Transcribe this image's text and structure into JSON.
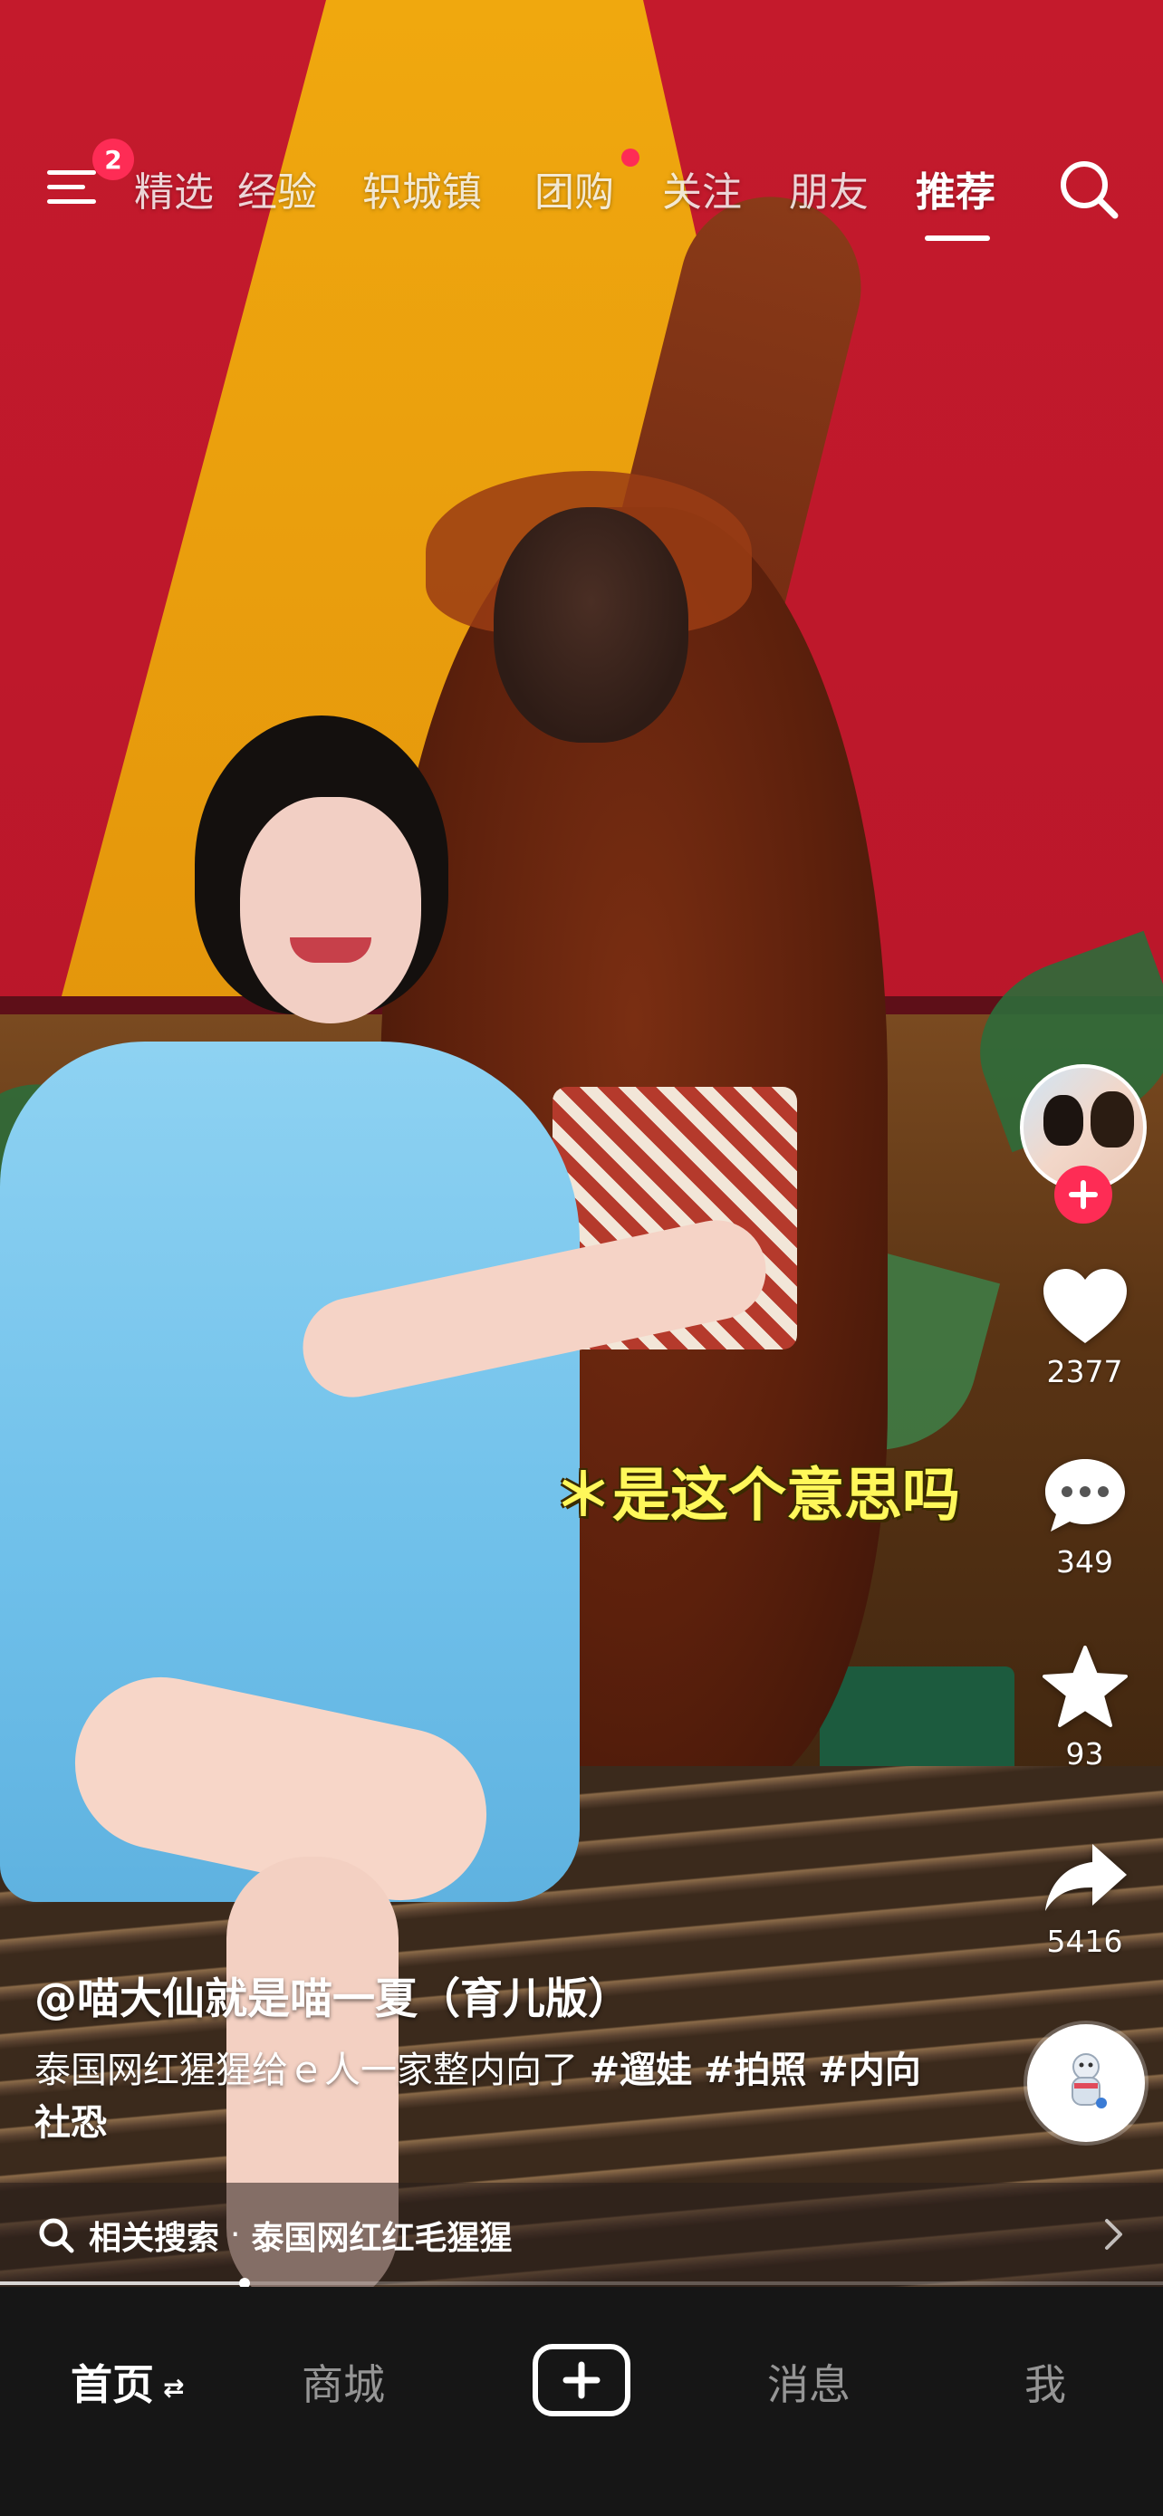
{
  "topnav": {
    "menu_badge": "2",
    "tabs": [
      {
        "label": "精选"
      },
      {
        "label": "经验"
      },
      {
        "label": "轵城镇"
      },
      {
        "label": "团购"
      },
      {
        "label": "关注"
      },
      {
        "label": "朋友"
      },
      {
        "label": "推荐"
      }
    ],
    "active_tab": "推荐",
    "accent_color": "#fe2c55"
  },
  "video": {
    "caption": "＊是这个意思吗"
  },
  "actions": {
    "likes": "2377",
    "comments": "349",
    "favorites": "93",
    "shares": "5416"
  },
  "post": {
    "author": "@喵大仙就是喵一夏（育儿版）",
    "description": "泰国网红猩猩给ｅ人一家整内向了",
    "hashtags": [
      "#遛娃",
      "#拍照",
      "#内向社恐"
    ]
  },
  "related_search": {
    "label": "相关搜索",
    "separator": "·",
    "term": "泰国网红红毛猩猩"
  },
  "playback": {
    "progress": 0.21
  },
  "tabbar": {
    "home": "首页",
    "home_refresh_icon": "⇄",
    "mall": "商城",
    "messages": "消息",
    "me": "我"
  },
  "icons": {
    "menu": "menu-icon",
    "search": "search-icon",
    "like": "heart-icon",
    "comment": "comment-icon",
    "favorite": "star-icon",
    "share": "share-icon",
    "create": "plus-icon"
  }
}
